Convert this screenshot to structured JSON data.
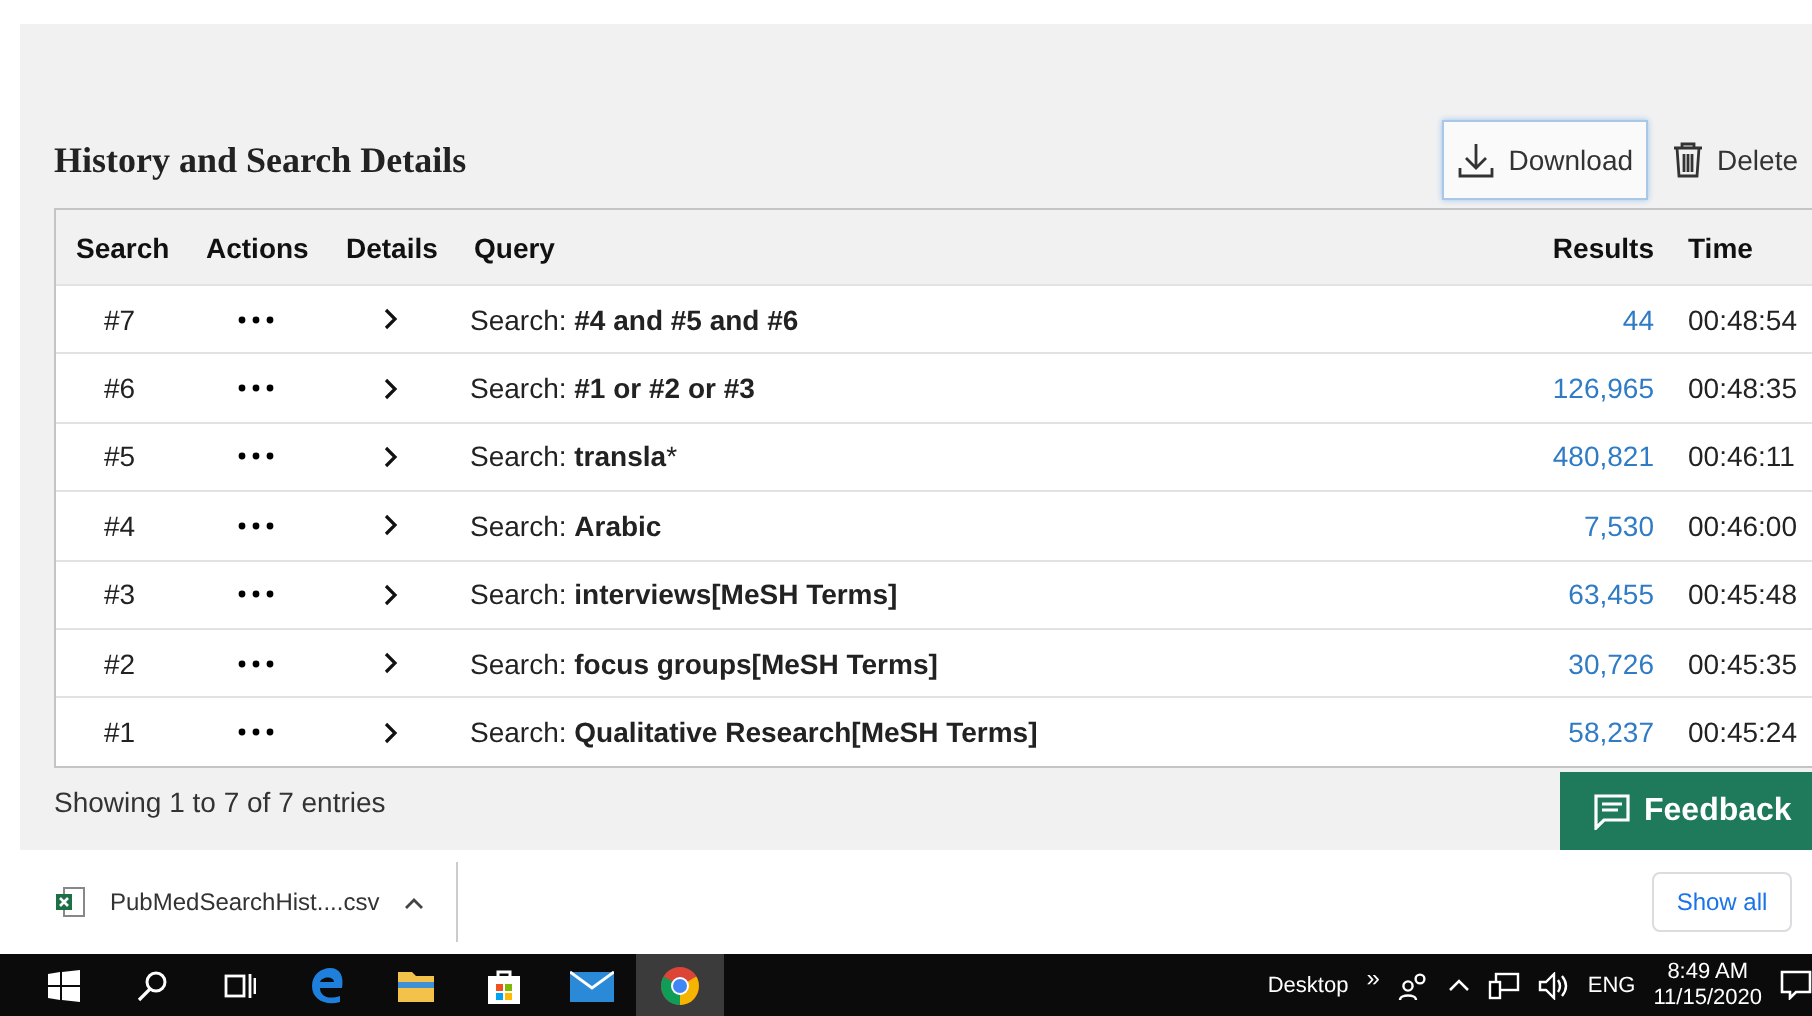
{
  "section": {
    "title": "History and Search Details"
  },
  "actions": [
    {
      "kind": "download",
      "label": "Download",
      "focused": true
    },
    {
      "kind": "delete",
      "label": "Delete",
      "focused": false
    }
  ],
  "table": {
    "columns": [
      "Search",
      "Actions",
      "Details",
      "Query",
      "Results",
      "Time"
    ],
    "rows": [
      {
        "search": "#7",
        "query": "Search: **#4 and #5 and #6**",
        "results": "44",
        "time": "00:48:54"
      },
      {
        "search": "#6",
        "query": "Search: **#1 or #2 or #3**",
        "results": "126,965",
        "time": "00:48:35"
      },
      {
        "search": "#5",
        "query": "Search: **transla***",
        "results": "480,821",
        "time": "00:46:11"
      },
      {
        "search": "#4",
        "query": "Search: **Arabic**",
        "results": "7,530",
        "time": "00:46:00"
      },
      {
        "search": "#3",
        "query": "Search: **interviews[MeSH Terms]**",
        "results": "63,455",
        "time": "00:45:48"
      },
      {
        "search": "#2",
        "query": "Search: **focus groups[MeSH Terms]**",
        "results": "30,726",
        "time": "00:45:35"
      },
      {
        "search": "#1",
        "query": "Search: **Qualitative Research[MeSH Terms]**",
        "results": "58,237",
        "time": "00:45:24"
      }
    ]
  },
  "footer": {
    "entries": "Showing 1 to 7 of 7 entries",
    "feedback": "Feedback"
  },
  "download_bar": {
    "file": "PubMedSearchHist....csv",
    "show_all": "Show all"
  },
  "taskbar": {
    "apps": [
      {
        "kind": "windows",
        "active": false
      },
      {
        "kind": "search",
        "active": false
      },
      {
        "kind": "taskview",
        "active": false
      },
      {
        "kind": "edge",
        "active": false
      },
      {
        "kind": "folder",
        "active": false
      },
      {
        "kind": "store",
        "active": false
      },
      {
        "kind": "mail",
        "active": false
      },
      {
        "kind": "chrome",
        "active": true
      }
    ],
    "desktop": "Desktop",
    "more": "»",
    "language": "ENG",
    "time": "8:49 AM",
    "date": "11/15/2020"
  }
}
